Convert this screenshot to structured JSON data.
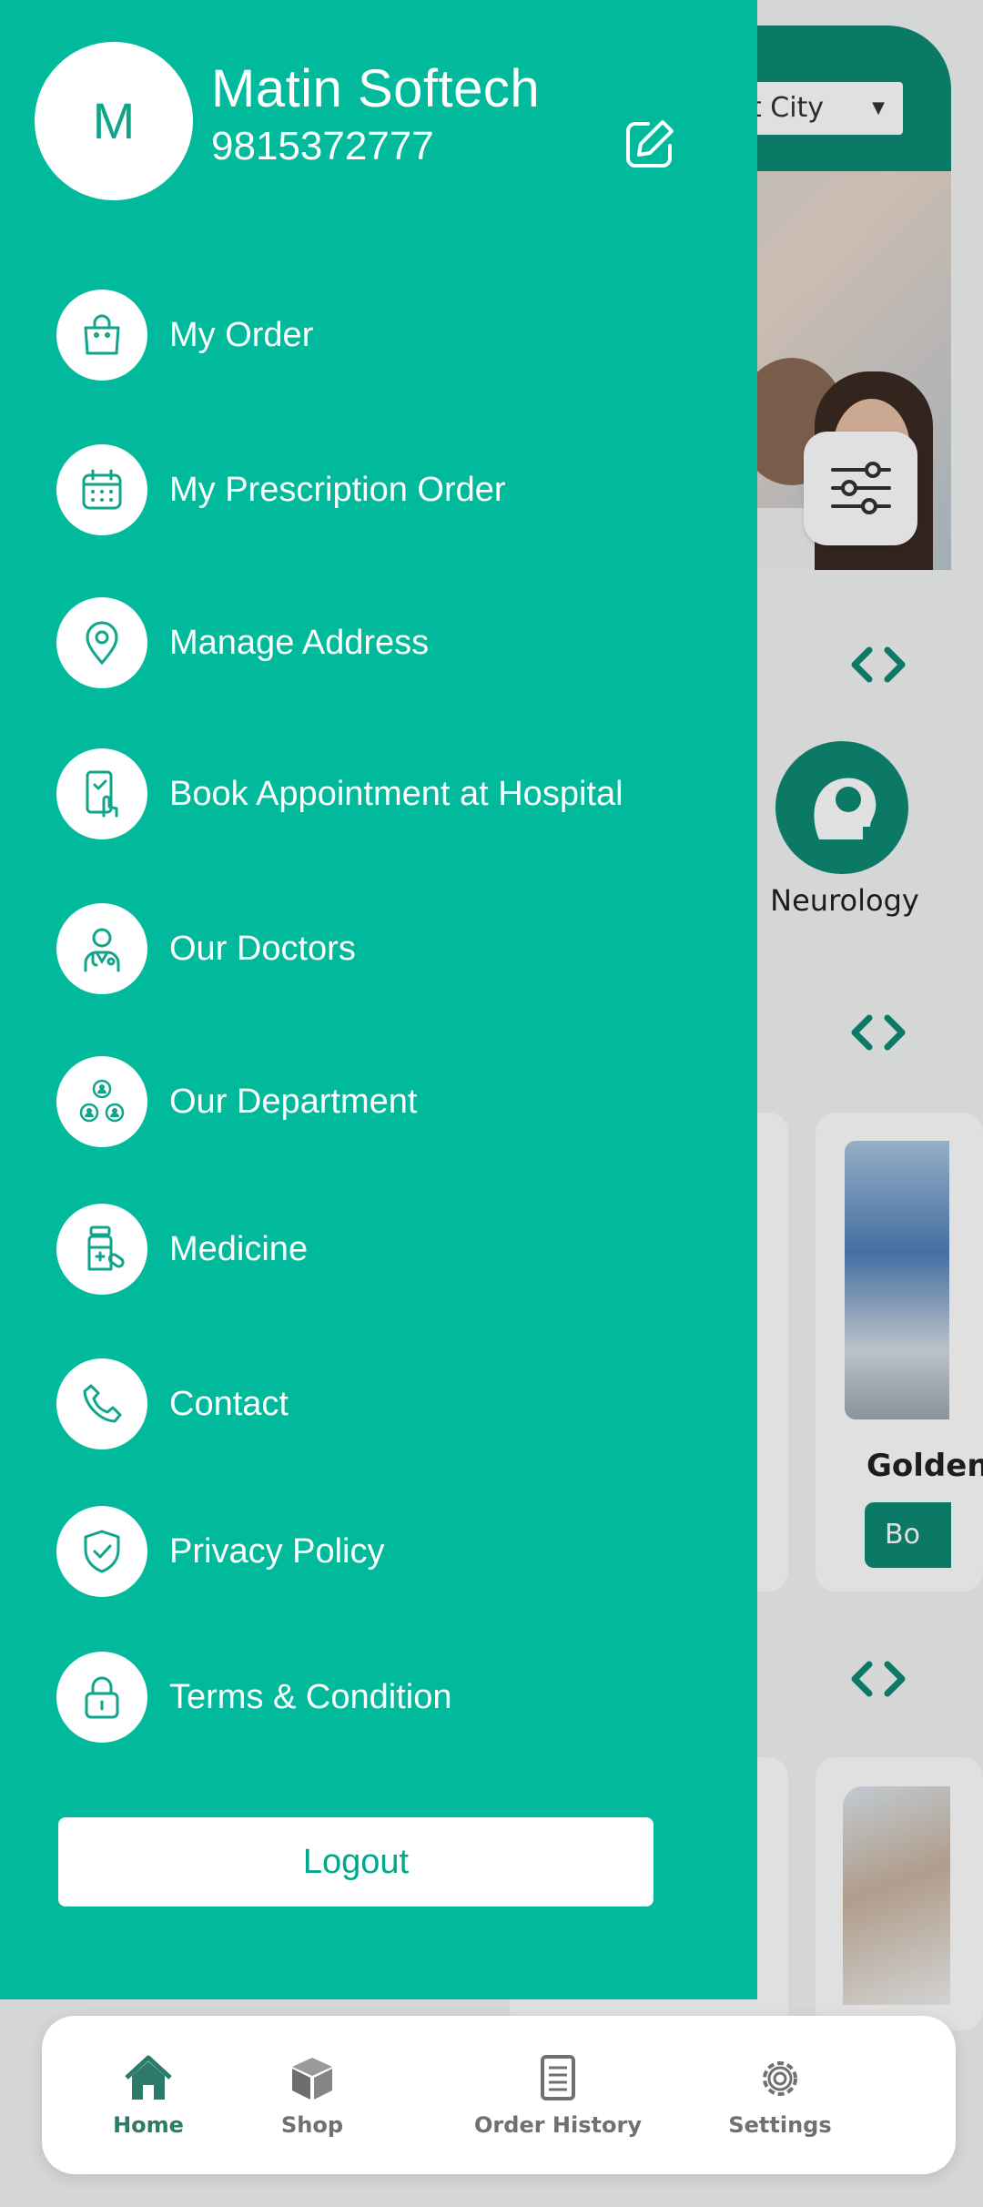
{
  "user": {
    "initial": "M",
    "name": "Matin Softech",
    "phone": "9815372777"
  },
  "background": {
    "select_city": "ect City",
    "department_label": "Neurology",
    "card_title": "Golden",
    "card_button": "Bo"
  },
  "menu": [
    {
      "label": "My Order",
      "icon": "shopping-bag-icon"
    },
    {
      "label": "My Prescription Order",
      "icon": "calendar-icon"
    },
    {
      "label": "Manage Address",
      "icon": "location-pin-icon"
    },
    {
      "label": "Book Appointment at Hospital",
      "icon": "phone-tap-icon"
    },
    {
      "label": "Our Doctors",
      "icon": "doctor-icon"
    },
    {
      "label": "Our Department",
      "icon": "team-network-icon"
    },
    {
      "label": "Medicine",
      "icon": "medicine-bottle-icon"
    },
    {
      "label": "Contact",
      "icon": "phone-icon"
    },
    {
      "label": "Privacy Policy",
      "icon": "shield-check-icon"
    },
    {
      "label": "Terms & Condition",
      "icon": "lock-icon"
    }
  ],
  "logout_label": "Logout",
  "bottom_nav": [
    {
      "label": "Home",
      "icon": "home-icon",
      "active": true
    },
    {
      "label": "Shop",
      "icon": "box-icon",
      "active": false
    },
    {
      "label": "Order History",
      "icon": "list-document-icon",
      "active": false
    },
    {
      "label": "Settings",
      "icon": "gear-icon",
      "active": false
    }
  ],
  "colors": {
    "drawer": "#00ba9b",
    "accent": "#0d8a73",
    "icon_teal": "#0fa58a"
  }
}
